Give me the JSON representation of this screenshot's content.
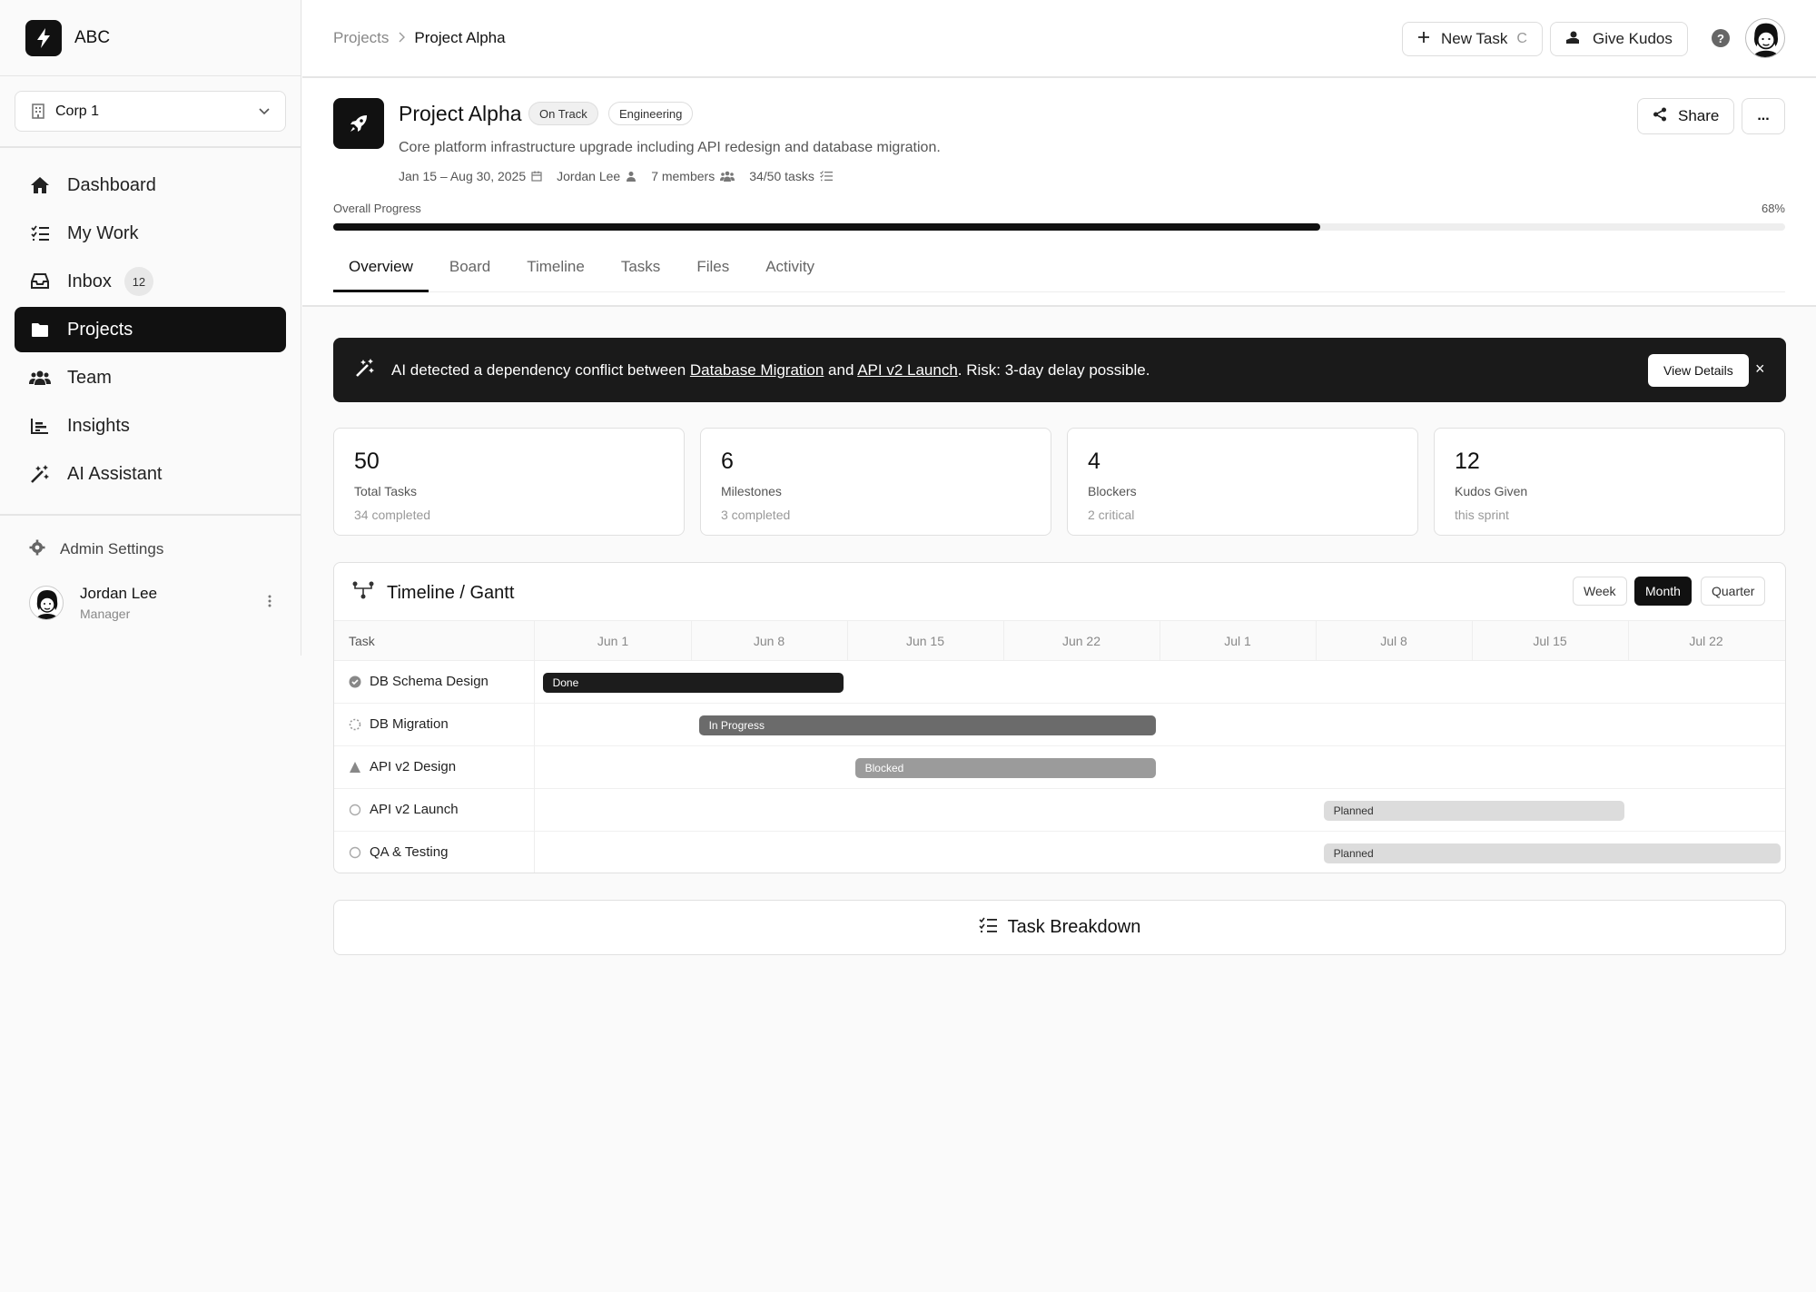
{
  "app": {
    "logo_text": "ABC"
  },
  "sidebar": {
    "org": "Corp 1",
    "items": [
      {
        "label": "Dashboard",
        "icon": "home-icon"
      },
      {
        "label": "My Work",
        "icon": "checklist-icon"
      },
      {
        "label": "Inbox",
        "icon": "inbox-icon",
        "badge": "12"
      },
      {
        "label": "Projects",
        "icon": "folder-icon",
        "active": true
      },
      {
        "label": "Team",
        "icon": "users-icon"
      },
      {
        "label": "Insights",
        "icon": "chart-icon"
      },
      {
        "label": "AI Assistant",
        "icon": "magic-wand-icon"
      }
    ],
    "admin_label": "Admin Settings",
    "user": {
      "name": "Jordan Lee",
      "role": "Manager"
    }
  },
  "topbar": {
    "breadcrumb": [
      "Projects",
      "Project Alpha"
    ],
    "new_task_label": "New Task",
    "new_task_shortcut": "C",
    "kudos_label": "Give Kudos",
    "help_label": "?"
  },
  "project": {
    "title": "Project Alpha",
    "status": "On Track",
    "tag": "Engineering",
    "description": "Core platform infrastructure upgrade including API redesign and database migration.",
    "dates": "Jan 15 – Aug 30, 2025",
    "owner": "Jordan Lee",
    "members": "7 members",
    "tasks": "34/50 tasks",
    "share_label": "Share",
    "more_label": "...",
    "progress_label": "Overall Progress",
    "progress_text": "68%",
    "progress_value": 0.68,
    "tabs": [
      "Overview",
      "Board",
      "Timeline",
      "Tasks",
      "Files",
      "Activity"
    ]
  },
  "alert": {
    "prefix": "AI detected a dependency conflict between ",
    "link1": "Database Migration",
    "middle": " and ",
    "link2": "API v2 Launch",
    "suffix": ". Risk: 3-day delay possible.",
    "button": "View Details",
    "close": "×"
  },
  "stats": [
    {
      "value": "50",
      "label": "Total Tasks",
      "sub": "34 completed"
    },
    {
      "value": "6",
      "label": "Milestones",
      "sub": "3 completed"
    },
    {
      "value": "4",
      "label": "Blockers",
      "sub": "2 critical"
    },
    {
      "value": "12",
      "label": "Kudos Given",
      "sub": "this sprint"
    }
  ],
  "gantt": {
    "title": "Timeline / Gantt",
    "views": [
      "Week",
      "Month",
      "Quarter"
    ],
    "active_view": "Month",
    "task_header": "Task",
    "weeks": [
      "Jun 1",
      "Jun 8",
      "Jun 15",
      "Jun 22",
      "Jul 1",
      "Jul 8",
      "Jul 15",
      "Jul 22"
    ],
    "rows": [
      {
        "name": "DB Schema Design",
        "status": "Done",
        "kind": "done",
        "start_week": 0.05,
        "end_week": 2.0
      },
      {
        "name": "DB Migration",
        "status": "In Progress",
        "kind": "progress",
        "start_week": 1.05,
        "end_week": 4.0
      },
      {
        "name": "API v2 Design",
        "status": "Blocked",
        "kind": "blocked",
        "start_week": 2.05,
        "end_week": 4.0
      },
      {
        "name": "API v2 Launch",
        "status": "Planned",
        "kind": "planned",
        "start_week": 5.05,
        "end_week": 7.0
      },
      {
        "name": "QA & Testing",
        "status": "Planned",
        "kind": "planned",
        "start_week": 5.05,
        "end_week": 8.0
      }
    ]
  },
  "breakdown": {
    "title": "Task Breakdown"
  }
}
